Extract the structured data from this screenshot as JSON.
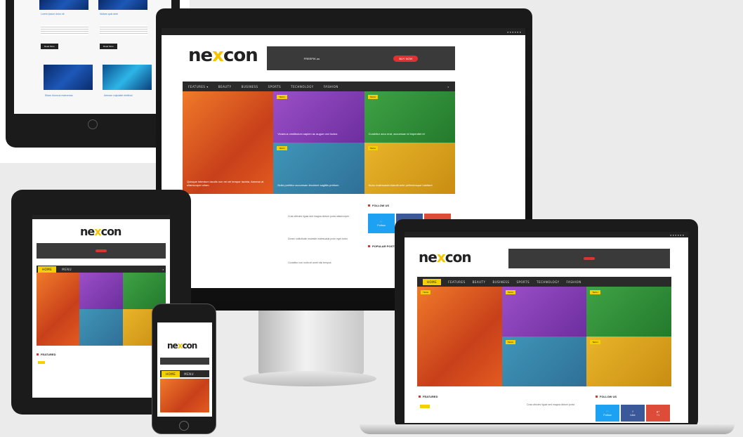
{
  "site": {
    "logo_left": "ne",
    "logo_x": "x",
    "logo_right": "con"
  },
  "colors": {
    "accent": "#f5d000",
    "nav_bg": "#2a2a2a",
    "red": "#e03030",
    "twitter": "#1da1f2",
    "facebook": "#3b5998",
    "google": "#dd4b39"
  },
  "monitor": {
    "nav": [
      "FEATURES ▾",
      "BEAUTY",
      "BUSINESS",
      "SPORTS",
      "TECHNOLOGY",
      "FASHION"
    ],
    "search_icon": "search-icon",
    "banner_label": "FREEPIK.us",
    "banner_button": "BUY NOW",
    "tiles": [
      {
        "tag": "",
        "title": "Quisque interdum iaculis non mi vel tempor lacinia. Aenean at ullamcorper ullam"
      },
      {
        "tag": "TECH",
        "title": "Vivamus vestibulum sapien ac augue orci luctus"
      },
      {
        "tag": "TECH",
        "title": "Curabitur arcu erat, accumsan id imperdiet et"
      },
      {
        "tag": "TECH",
        "title": "Nulla porttitor accumsan tincidunt sagittis pretium"
      },
      {
        "tag": "TECH",
        "title": "Nunc malesuada blandit ante pellentesque habitant"
      }
    ],
    "list": [
      "Cras ultricies ligula sed magna dictum porta ullamcorper",
      "Donec sollicitudin molestie malesuada proin eget tortor",
      "Curabitur non nulla sit amet nisl tempus"
    ],
    "follow_title": "FOLLOW US",
    "popular_title": "POPULAR POSTS",
    "social": [
      {
        "icon": "twitter-icon",
        "label": "Follow"
      },
      {
        "icon": "facebook-icon",
        "label": "Like"
      },
      {
        "icon": "google-icon",
        "label": "Follow"
      }
    ]
  },
  "laptop": {
    "nav": [
      "HOME",
      "FEATURES",
      "BEAUTY",
      "BUSINESS",
      "SPORTS",
      "TECHNOLOGY",
      "FASHION"
    ],
    "section_title": "FEATURED",
    "tag": "TECH",
    "side_title": "FOLLOW US",
    "list_item": "Cras ultricies ligula sed magna dictum porta",
    "social_labels": [
      "Follow",
      "Like",
      "+1"
    ]
  },
  "tablet": {
    "nav": [
      "HOME",
      "MENU"
    ],
    "section_title": "FEATURED"
  },
  "phone": {
    "nav": [
      "HOME",
      "MENU"
    ]
  },
  "ipad_top": {
    "captions": [
      "Lorem ipsum dolor sit",
      "Nullam quis ante"
    ],
    "read_more": "Read More",
    "bottom_captions": [
      "Etiam rhoncus maecenas",
      "Aenean vulputate eleifend"
    ]
  }
}
